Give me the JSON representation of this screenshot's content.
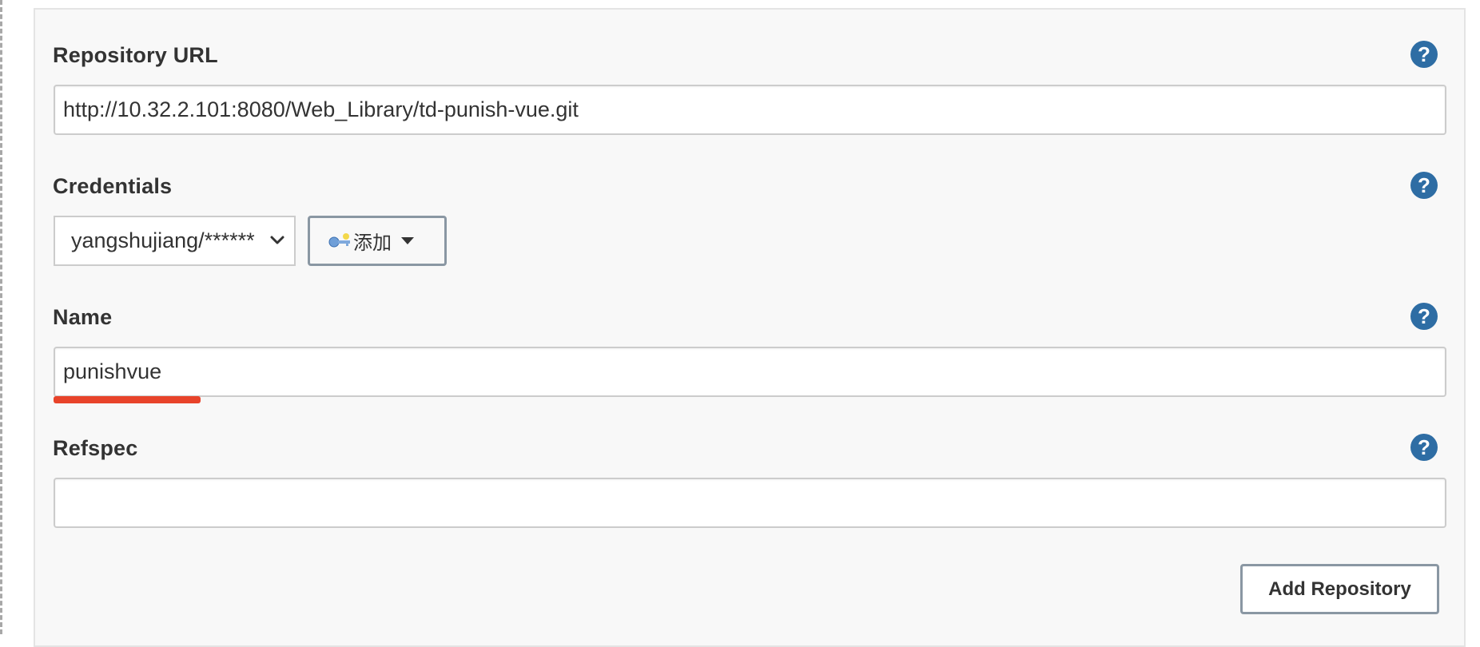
{
  "repository_url": {
    "label": "Repository URL",
    "value": "http://10.32.2.101:8080/Web_Library/td-punish-vue.git",
    "help": "?"
  },
  "credentials": {
    "label": "Credentials",
    "selected": "yangshujiang/******",
    "add_button_label": "添加",
    "help": "?"
  },
  "name": {
    "label": "Name",
    "value": "punishvue",
    "help": "?",
    "highlight_color": "#e8432a"
  },
  "refspec": {
    "label": "Refspec",
    "value": "",
    "help": "?"
  },
  "add_repository_label": "Add Repository",
  "colors": {
    "help_icon": "#2e6da4",
    "panel_bg": "#f8f8f8"
  }
}
